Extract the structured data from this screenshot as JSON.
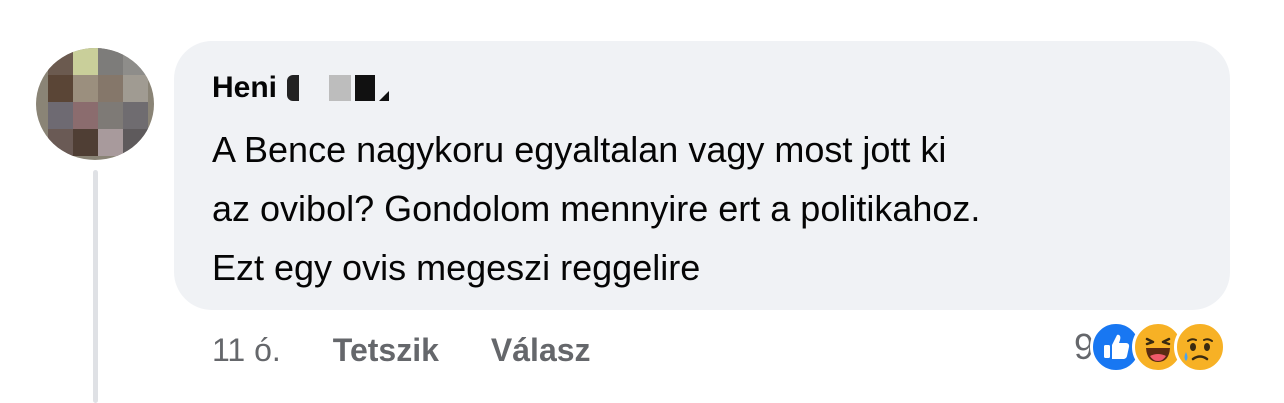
{
  "comment": {
    "author_name": "Heni",
    "text": "A Bence nagykoru egyaltalan vagy most jott ki\naz ovibol? Gondolom mennyire ert a politikahoz.\nEzt egy ovis megeszi reggelire",
    "timestamp": "11 ó.",
    "like_label": "Tetszik",
    "reply_label": "Válasz",
    "reaction_count": "9",
    "reactions": [
      "like-icon",
      "haha-icon",
      "sad-icon"
    ]
  },
  "colors": {
    "bubble_bg": "#f0f2f5",
    "like_blue": "#1877f2",
    "meta_gray": "#65676b",
    "thread_line": "#dfe1e5"
  }
}
